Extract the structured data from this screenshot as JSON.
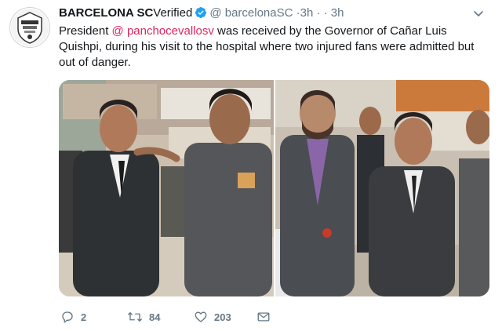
{
  "tweet": {
    "author_name": "BARCELONA SC",
    "verified_text": "Verified",
    "handle": "@ barcelonaSC",
    "time": "·3h · · 3h",
    "text_before": "President ",
    "mention": "@ panchocevallosv",
    "text_after": " was received by the Governor of Cañar Luis Quishpi, during his visit to the hospital where two injured fans were admitted but out of danger.",
    "reply_count": "2",
    "retweet_count": "84",
    "like_count": "203"
  },
  "icons": {
    "avatar": "barcelona-sc-crest",
    "verified": "verified-badge-icon",
    "menu": "chevron-down-icon",
    "reply": "reply-icon",
    "retweet": "retweet-icon",
    "like": "heart-icon",
    "dm": "envelope-icon"
  },
  "colors": {
    "accent": "#1da1f2",
    "mention": "#e0245e",
    "muted": "#657786",
    "text": "#14171a"
  }
}
